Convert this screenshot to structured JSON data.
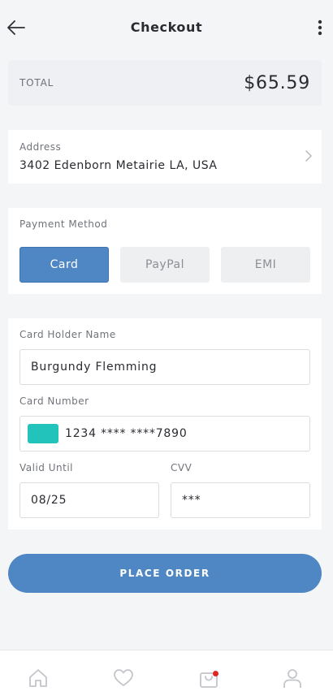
{
  "header": {
    "title": "Checkout",
    "back_icon": "arrow-left-icon",
    "menu_icon": "more-vertical-icon"
  },
  "total": {
    "label": "TOTAL",
    "amount": "$65.59"
  },
  "address": {
    "label": "Address",
    "value": "3402 Edenborn Metairie LA, USA"
  },
  "payment": {
    "label": "Payment Method",
    "methods": [
      "Card",
      "PayPal",
      "EMI"
    ],
    "selected": "Card"
  },
  "card_form": {
    "holder_label": "Card Holder Name",
    "holder_value": "Burgundy Flemming",
    "number_label": "Card Number",
    "number_value": "1234 **** ****7890",
    "valid_label": "Valid Until",
    "valid_value": "08/25",
    "cvv_label": "CVV",
    "cvv_value": "***"
  },
  "place_order_label": "PLACE ORDER",
  "bottom_nav": {
    "items": [
      "home-icon",
      "heart-icon",
      "shopping-bag-icon",
      "user-icon"
    ],
    "cart_badge": true
  },
  "colors": {
    "accent": "#4f86c4",
    "card_chip": "#22c3bb",
    "badge": "#e02525",
    "background": "#f4f5f7"
  }
}
